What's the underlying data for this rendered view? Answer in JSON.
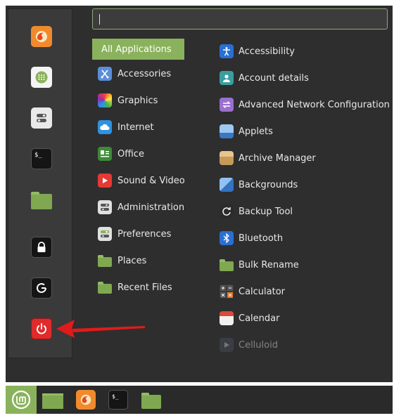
{
  "search": {
    "value": ""
  },
  "favorites": [
    {
      "name": "firefox-icon",
      "color": "#ef7b2c"
    },
    {
      "name": "software-manager-icon",
      "color": "#ffffff"
    },
    {
      "name": "settings-icon",
      "color": "#e6e6e6"
    },
    {
      "name": "terminal-icon",
      "color": "#1b1b1b",
      "glyph": "$_"
    },
    {
      "name": "files-folder-icon",
      "color": "#7fa851"
    }
  ],
  "session": [
    {
      "name": "lock-screen-icon",
      "glyph": "🔒"
    },
    {
      "name": "logout-icon",
      "glyph": "⟲"
    },
    {
      "name": "power-off-icon",
      "glyph": "⏻",
      "color": "#e12a2a"
    }
  ],
  "categories": [
    {
      "label": "All Applications",
      "selected": true
    },
    {
      "label": "Accessories",
      "color": "#5a8ed8"
    },
    {
      "label": "Graphics",
      "color": "#d24bd8"
    },
    {
      "label": "Internet",
      "color": "#2d93e0"
    },
    {
      "label": "Office",
      "color": "#4e9a3a"
    },
    {
      "label": "Sound & Video",
      "color": "#e53935"
    },
    {
      "label": "Administration",
      "color": "#d8d8d8"
    },
    {
      "label": "Preferences",
      "color": "#d8d8d8"
    },
    {
      "label": "Places",
      "color": "#7fa851"
    },
    {
      "label": "Recent Files",
      "color": "#7fa851"
    }
  ],
  "apps": [
    {
      "label": "Accessibility",
      "color": "#2a6fd2"
    },
    {
      "label": "Account details",
      "color": "#3a9ea0"
    },
    {
      "label": "Advanced Network Configuration",
      "color": "#9a6fcf"
    },
    {
      "label": "Applets",
      "color": "#4a90d9"
    },
    {
      "label": "Archive Manager",
      "color": "#c8a36a"
    },
    {
      "label": "Backgrounds",
      "color": "#3f8fdc"
    },
    {
      "label": "Backup Tool",
      "color": "#3a3a3a"
    },
    {
      "label": "Bluetooth",
      "color": "#2a6fd2"
    },
    {
      "label": "Bulk Rename",
      "color": "#7fa851"
    },
    {
      "label": "Calculator",
      "color": "#555555"
    },
    {
      "label": "Calendar",
      "color": "#e8e8e8"
    },
    {
      "label": "Celluloid",
      "color": "#555a66",
      "faded": true
    }
  ],
  "taskbar": [
    {
      "name": "start-menu-mint-icon"
    },
    {
      "name": "taskbar-desktop-icon"
    },
    {
      "name": "taskbar-firefox-icon"
    },
    {
      "name": "taskbar-terminal-icon"
    },
    {
      "name": "taskbar-files-icon"
    }
  ],
  "annotation": {
    "arrow_color": "#e11b1b"
  }
}
